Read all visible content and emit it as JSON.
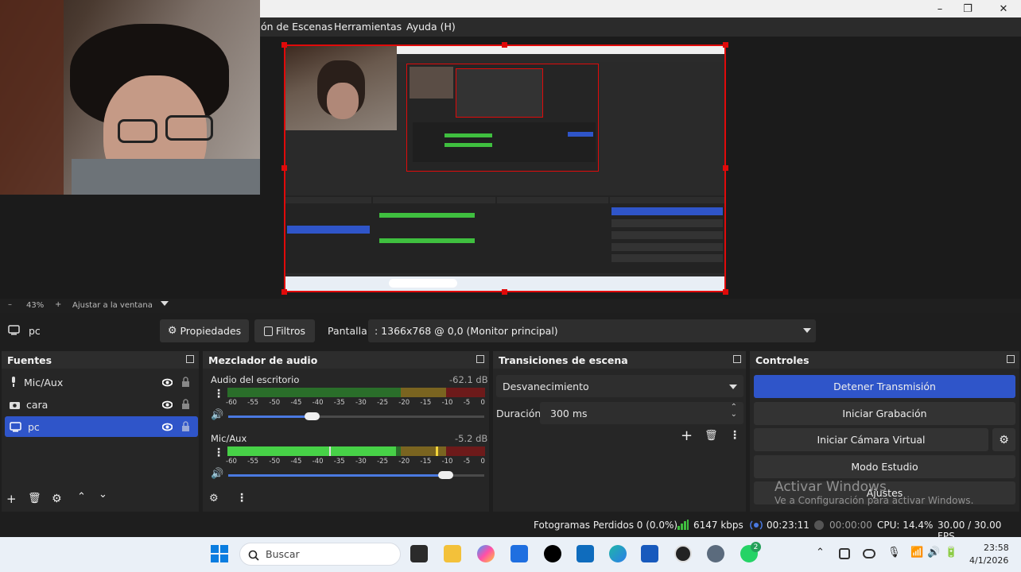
{
  "window": {
    "minimize": "–",
    "maximize": "❐",
    "close": "✕"
  },
  "menu": {
    "items": [
      "ón de Escenas",
      "Herramientas",
      "Ayuda (H)"
    ]
  },
  "zoom": {
    "minus": "–",
    "level": "43%",
    "plus": "+",
    "fit": "Ajustar a la ventana"
  },
  "source_toolbar": {
    "source_name": "pc",
    "properties": "Propiedades",
    "filters": "Filtros",
    "display_label": "Pantalla",
    "display_value": ": 1366x768 @ 0,0 (Monitor principal)"
  },
  "sources": {
    "title": "Fuentes",
    "items": [
      {
        "label": "Mic/Aux",
        "icon": "mic-icon"
      },
      {
        "label": "cara",
        "icon": "camera-icon"
      },
      {
        "label": "pc",
        "icon": "monitor-icon",
        "selected": true
      }
    ]
  },
  "mixer": {
    "title": "Mezclador de audio",
    "channels": [
      {
        "name": "Audio del escritorio",
        "db": "-62.1 dB",
        "volume": 0.33
      },
      {
        "name": "Mic/Aux",
        "db": "-5.2 dB",
        "volume": 0.85
      }
    ],
    "ticks": [
      "-60",
      "-55",
      "-50",
      "-45",
      "-40",
      "-35",
      "-30",
      "-25",
      "-20",
      "-15",
      "-10",
      "-5",
      "0"
    ]
  },
  "transitions": {
    "title": "Transiciones de escena",
    "selected": "Desvanecimiento",
    "duration_label": "Duración",
    "duration_value": "300 ms"
  },
  "controls": {
    "title": "Controles",
    "stop_stream": "Detener Transmisión",
    "start_recording": "Iniciar Grabación",
    "start_virtual_cam": "Iniciar Cámara Virtual",
    "studio_mode": "Modo Estudio",
    "settings": "Ajustes"
  },
  "watermark": {
    "line1": "Activar Windows",
    "line2": "Ve a Configuración para activar Windows."
  },
  "status": {
    "dropped_frames": "Fotogramas Perdidos 0 (0.0%)",
    "bitrate": "6147 kbps",
    "stream_time": "00:23:11",
    "rec_time": "00:00:00",
    "cpu": "CPU: 14.4%",
    "fps": "30.00 / 30.00 FPS"
  },
  "taskbar": {
    "search_placeholder": "Buscar",
    "time": "23:58",
    "date": "4/1/2026",
    "whatsapp_badge": "2"
  },
  "colors": {
    "accent": "#2f55c9",
    "selection_red": "#e00a0a",
    "meter_green": "#3fbf3f",
    "meter_yellow": "#c9a229",
    "meter_red": "#b52b2b"
  }
}
